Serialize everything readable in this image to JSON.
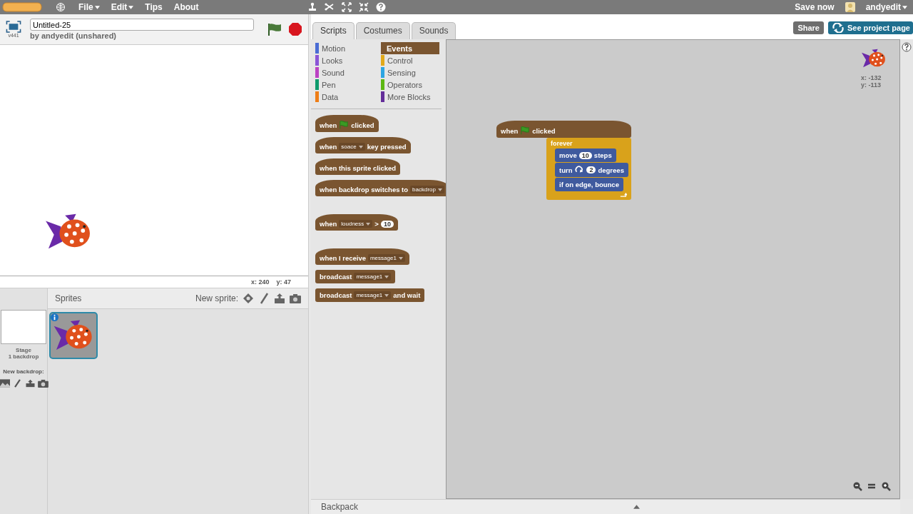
{
  "menubar": {
    "menus": [
      {
        "label": "File",
        "kind": "dropdown"
      },
      {
        "label": "Edit",
        "kind": "dropdown"
      },
      {
        "label": "Tips",
        "kind": "link"
      },
      {
        "label": "About",
        "kind": "link"
      }
    ],
    "save": "Save now",
    "user": "andyedit"
  },
  "project": {
    "title": "Untitled-25",
    "byline": "by andyedit (unshared)",
    "version": "v441"
  },
  "stage": {
    "x": "x: 240",
    "y": "y: 47"
  },
  "sprites": {
    "title": "Sprites",
    "new_sprite": "New sprite:",
    "stage_label": "Stage",
    "stage_sub": "1 backdrop",
    "new_backdrop": "New backdrop:",
    "items": [
      {
        "selected": true
      }
    ]
  },
  "tabs": [
    {
      "label": "Scripts",
      "selected": true
    },
    {
      "label": "Costumes",
      "selected": false
    },
    {
      "label": "Sounds",
      "selected": false
    }
  ],
  "buttons": {
    "share": "Share",
    "project_page": "See project page"
  },
  "categories": [
    {
      "label": "Motion",
      "color": "#4a6cd4",
      "selected": false
    },
    {
      "label": "Looks",
      "color": "#8a55d7",
      "selected": false
    },
    {
      "label": "Sound",
      "color": "#bb42c3",
      "selected": false
    },
    {
      "label": "Pen",
      "color": "#0e9a6c",
      "selected": false
    },
    {
      "label": "Data",
      "color": "#ee7d16",
      "selected": false
    },
    {
      "label": "Events",
      "color": "#7a5530",
      "selected": true
    },
    {
      "label": "Control",
      "color": "#e1a91a",
      "selected": false
    },
    {
      "label": "Sensing",
      "color": "#2ca5e2",
      "selected": false
    },
    {
      "label": "Operators",
      "color": "#5cb712",
      "selected": false
    },
    {
      "label": "More Blocks",
      "color": "#632d99",
      "selected": false
    }
  ],
  "palette_groups": [
    [
      {
        "hat": true,
        "parts": [
          {
            "kind": "text",
            "text": "when"
          },
          {
            "kind": "flag"
          },
          {
            "kind": "text",
            "text": "clicked"
          }
        ]
      },
      {
        "hat": true,
        "parts": [
          {
            "kind": "text",
            "text": "when"
          },
          {
            "kind": "dropdown",
            "text": "soace"
          },
          {
            "kind": "text",
            "text": "key pressed"
          }
        ]
      },
      {
        "hat": true,
        "parts": [
          {
            "kind": "text",
            "text": "when this sprite clicked"
          }
        ]
      },
      {
        "hat": true,
        "parts": [
          {
            "kind": "text",
            "text": "when backdrop switches to"
          },
          {
            "kind": "dropdown",
            "text": "backdrop"
          }
        ]
      }
    ],
    [
      {
        "hat": true,
        "parts": [
          {
            "kind": "text",
            "text": "when"
          },
          {
            "kind": "dropdown",
            "text": "loudness"
          },
          {
            "kind": "text",
            "text": ">"
          },
          {
            "kind": "number",
            "text": "10"
          }
        ]
      }
    ],
    [
      {
        "hat": true,
        "parts": [
          {
            "kind": "text",
            "text": "when I receive"
          },
          {
            "kind": "dropdown",
            "text": "message1"
          }
        ]
      },
      {
        "hat": false,
        "parts": [
          {
            "kind": "text",
            "text": "broadcast"
          },
          {
            "kind": "dropdown",
            "text": "message1"
          }
        ]
      },
      {
        "hat": false,
        "parts": [
          {
            "kind": "text",
            "text": "broadcast"
          },
          {
            "kind": "dropdown",
            "text": "message1"
          },
          {
            "kind": "text",
            "text": "and wait"
          }
        ]
      }
    ]
  ],
  "script": {
    "hat": {
      "parts": [
        {
          "kind": "text",
          "text": "when"
        },
        {
          "kind": "flag"
        },
        {
          "kind": "text",
          "text": "clicked"
        }
      ]
    },
    "forever": {
      "label": "forever",
      "children": [
        {
          "parts": [
            {
              "kind": "text",
              "text": "move"
            },
            {
              "kind": "number",
              "text": "10"
            },
            {
              "kind": "text",
              "text": "steps"
            }
          ]
        },
        {
          "parts": [
            {
              "kind": "text",
              "text": "turn"
            },
            {
              "kind": "turn"
            },
            {
              "kind": "number",
              "text": "2"
            },
            {
              "kind": "text",
              "text": "degrees"
            }
          ]
        },
        {
          "parts": [
            {
              "kind": "text",
              "text": "if on edge, bounce"
            }
          ]
        }
      ]
    }
  },
  "sprite_info": {
    "x": "x: -132",
    "y": "y: -113"
  },
  "backpack": "Backpack"
}
